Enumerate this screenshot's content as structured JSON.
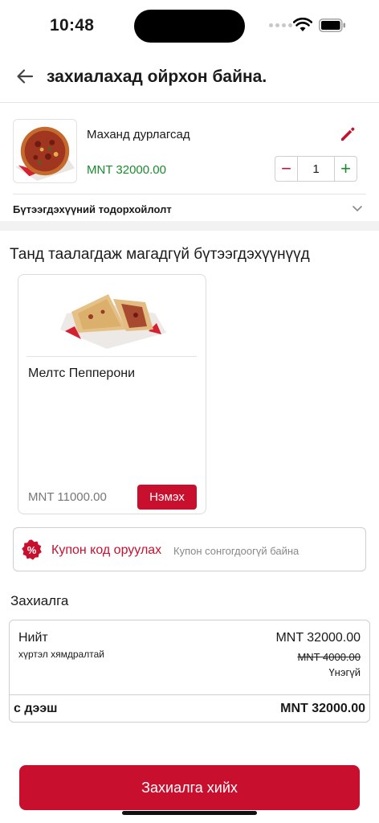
{
  "status_bar": {
    "time": "10:48"
  },
  "header": {
    "title": "захиалахад ойрхон байна."
  },
  "cart_item": {
    "name": "Маханд дурлагсад",
    "price": "MNT 32000.00",
    "quantity": "1",
    "minus": "−",
    "plus": "+",
    "details_label": "Бүтээгдэхүүний тодорхойлолт"
  },
  "suggestions": {
    "title": "Танд таалагдаж магадгүй бүтээгдэхүүнүүд",
    "items": [
      {
        "name": "Мелтс Пепперони",
        "price": "MNT 11000.00",
        "add_label": "Нэмэх"
      }
    ]
  },
  "coupon": {
    "label": "Купон код оруулах",
    "status": "Купон сонгогдоогүй байна",
    "icon_glyph": "%"
  },
  "order": {
    "title": "Захиалга",
    "total_label": "Нийт",
    "total_value": "MNT 32000.00",
    "delivery_label": "хүртэл хямдралтай",
    "delivery_old": "MNT 4000.00",
    "delivery_free": "Үнэгүй",
    "grand_label": "с дээш",
    "grand_value": "MNT 32000.00"
  },
  "place_order": {
    "label": "Захиалга хийх"
  },
  "colors": {
    "accent": "#c8102e",
    "price_green": "#1a8a2e"
  }
}
